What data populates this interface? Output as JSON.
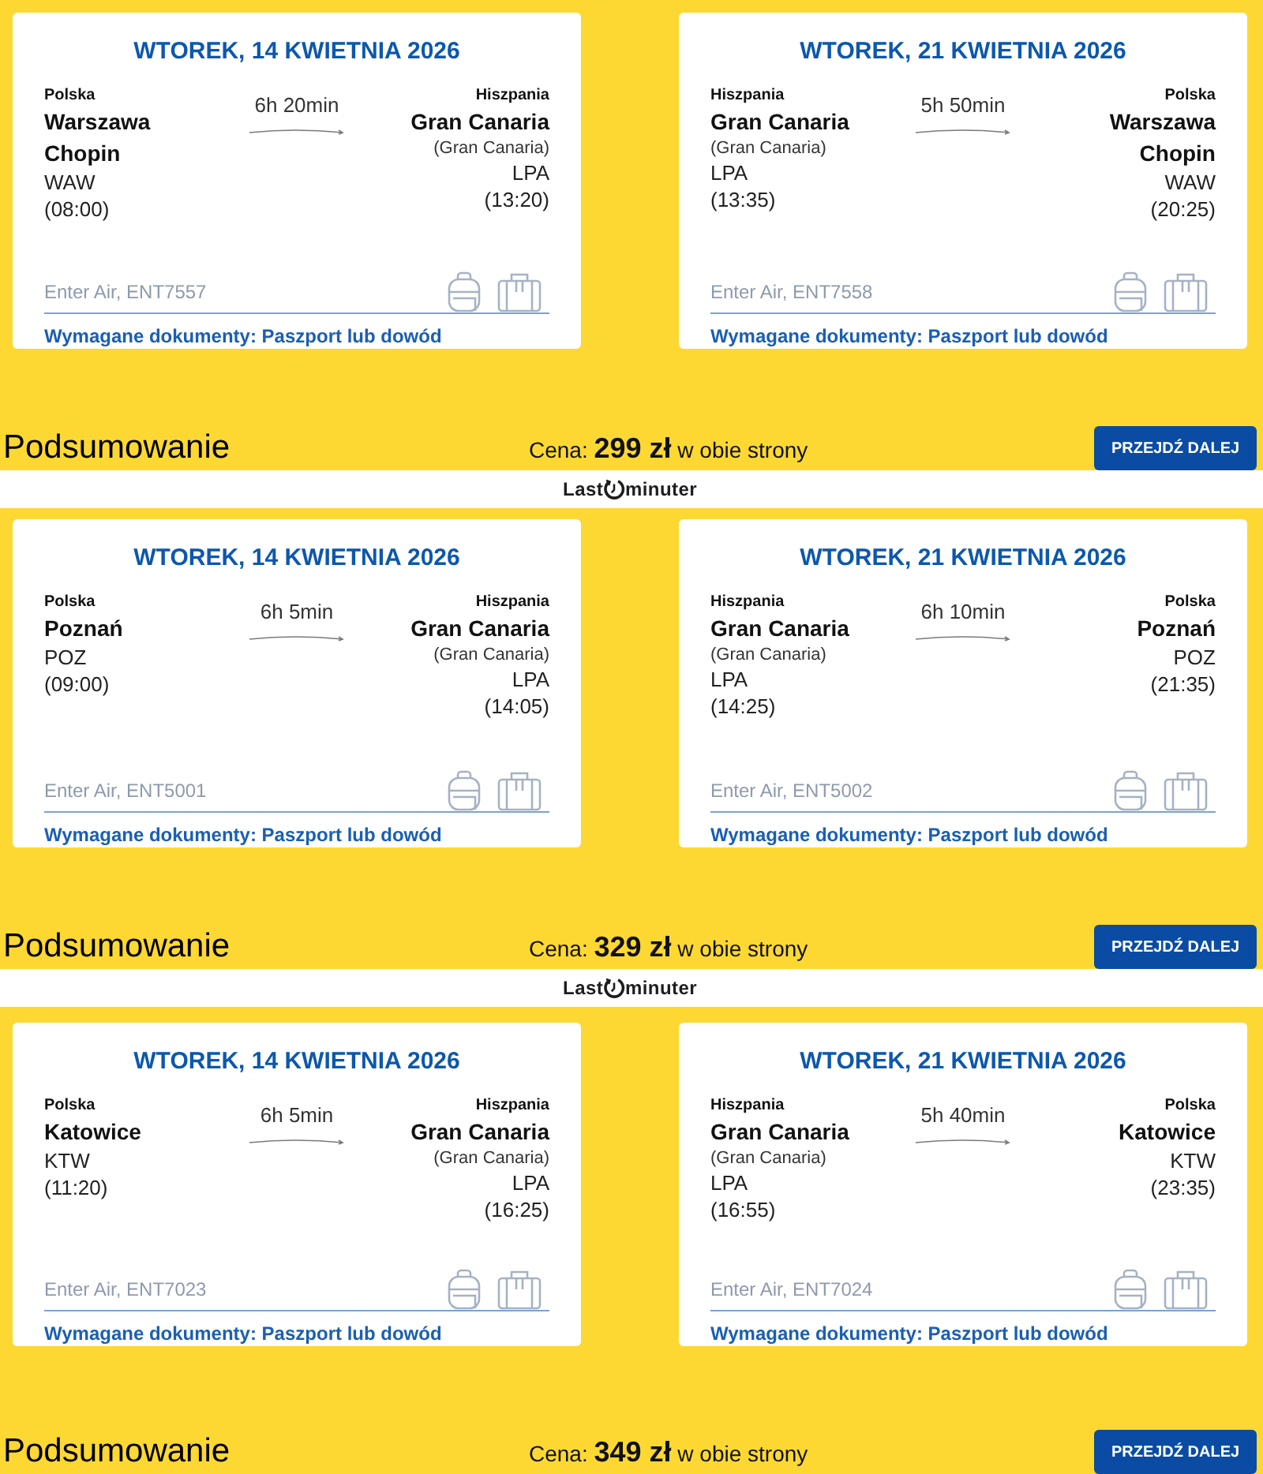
{
  "panels": [
    {
      "kind": "offer",
      "flights": [
        {
          "date": "WTOREK, 14 KWIETNIA 2026",
          "origin": {
            "country": "Polska",
            "city": "Warszawa Chopin",
            "code": "WAW",
            "time": "(08:00)"
          },
          "duration": "6h 20min",
          "destination": {
            "country": "Hiszpania",
            "city": "Gran Canaria",
            "area": "(Gran Canaria)",
            "code": "LPA",
            "time": "(13:20)"
          },
          "carrier": "Enter Air, ENT7557",
          "documents": "Wymagane dokumenty: Paszport lub dowód"
        },
        {
          "date": "WTOREK, 21 KWIETNIA 2026",
          "origin": {
            "country": "Hiszpania",
            "city": "Gran Canaria",
            "area": "(Gran Canaria)",
            "code": "LPA",
            "time": "(13:35)"
          },
          "duration": "5h 50min",
          "destination": {
            "country": "Polska",
            "city": "Warszawa Chopin",
            "code": "WAW",
            "time": "(20:25)"
          },
          "carrier": "Enter Air, ENT7558",
          "documents": "Wymagane dokumenty: Paszport lub dowód"
        }
      ],
      "summary": {
        "title": "Podsumowanie",
        "price": "Cena: **299 zł** w obie strony",
        "button": "PRZEJDŹ DALEJ"
      }
    },
    {
      "kind": "logo_banner",
      "logo": {
        "text_before": "Last",
        "text_after": "minuter"
      }
    },
    {
      "kind": "offer",
      "flights": [
        {
          "date": "WTOREK, 14 KWIETNIA 2026",
          "origin": {
            "country": "Polska",
            "city": "Poznań",
            "code": "POZ",
            "time": "(09:00)"
          },
          "duration": "6h 5min",
          "destination": {
            "country": "Hiszpania",
            "city": "Gran Canaria",
            "area": "(Gran Canaria)",
            "code": "LPA",
            "time": "(14:05)"
          },
          "carrier": "Enter Air, ENT5001",
          "documents": "Wymagane dokumenty: Paszport lub dowód"
        },
        {
          "date": "WTOREK, 21 KWIETNIA 2026",
          "origin": {
            "country": "Hiszpania",
            "city": "Gran Canaria",
            "area": "(Gran Canaria)",
            "code": "LPA",
            "time": "(14:25)"
          },
          "duration": "6h 10min",
          "destination": {
            "country": "Polska",
            "city": "Poznań",
            "code": "POZ",
            "time": "(21:35)"
          },
          "carrier": "Enter Air, ENT5002",
          "documents": "Wymagane dokumenty: Paszport lub dowód"
        }
      ],
      "summary": {
        "title": "Podsumowanie",
        "price": "Cena: **329 zł** w obie strony",
        "button": "PRZEJDŹ DALEJ"
      }
    },
    {
      "kind": "logo_banner",
      "logo": {
        "text_before": "Last",
        "text_after": "minuter"
      }
    },
    {
      "kind": "offer",
      "flights": [
        {
          "date": "WTOREK, 14 KWIETNIA 2026",
          "origin": {
            "country": "Polska",
            "city": "Katowice",
            "code": "KTW",
            "time": "(11:20)"
          },
          "duration": "6h 5min",
          "destination": {
            "country": "Hiszpania",
            "city": "Gran Canaria",
            "area": "(Gran Canaria)",
            "code": "LPA",
            "time": "(16:25)"
          },
          "carrier": "Enter Air, ENT7023",
          "documents": "Wymagane dokumenty: Paszport lub dowód"
        },
        {
          "date": "WTOREK, 21 KWIETNIA 2026",
          "origin": {
            "country": "Hiszpania",
            "city": "Gran Canaria",
            "area": "(Gran Canaria)",
            "code": "LPA",
            "time": "(16:55)"
          },
          "duration": "5h 40min",
          "destination": {
            "country": "Polska",
            "city": "Katowice",
            "code": "KTW",
            "time": "(23:35)"
          },
          "carrier": "Enter Air, ENT7024",
          "documents": "Wymagane dokumenty: Paszport lub dowód"
        }
      ],
      "summary": {
        "title": "Podsumowanie",
        "price": "Cena: **349 zł** w obie strony",
        "button": "PRZEJDŹ DALEJ"
      }
    }
  ]
}
